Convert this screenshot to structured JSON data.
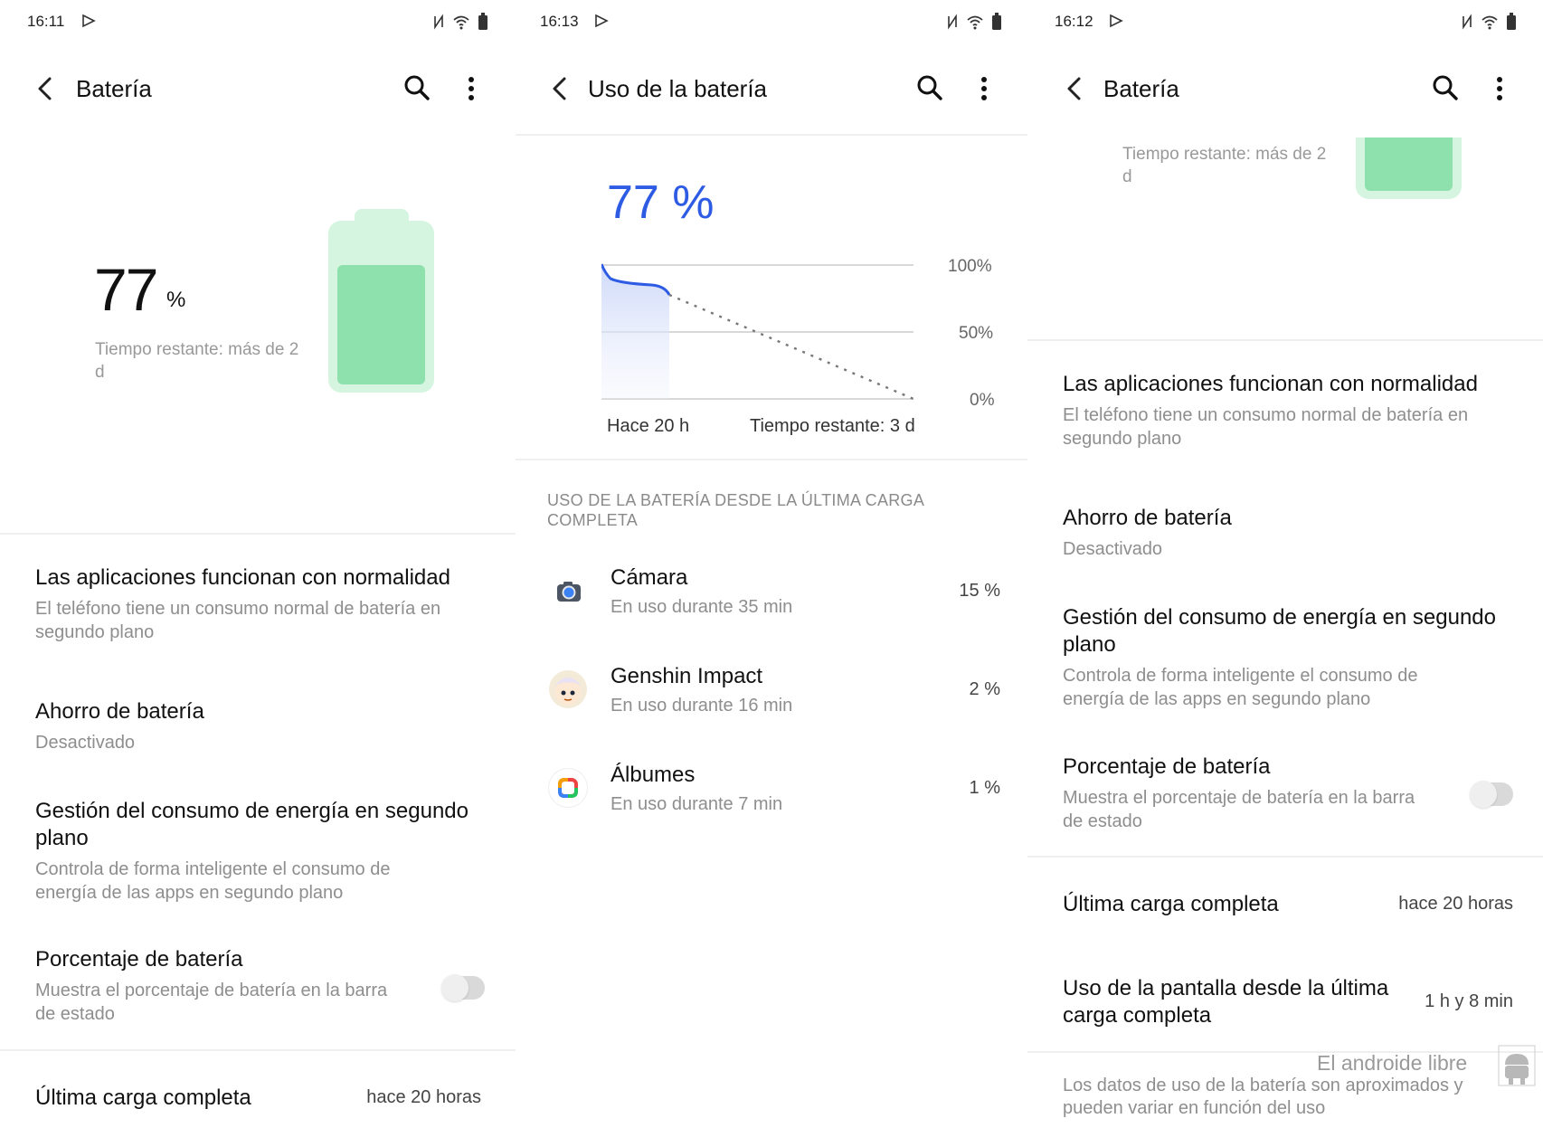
{
  "panel1": {
    "status_time": "16:11",
    "title": "Batería",
    "battery_percent": "77",
    "battery_percent_unit": "%",
    "battery_level": 0.77,
    "time_remaining": "Tiempo restante: más de 2",
    "time_remaining_2": "d",
    "items": [
      {
        "title": "Las aplicaciones funcionan con normalidad",
        "subtitle": "El teléfono tiene un consumo normal de batería en",
        "subtitle2": "segundo plano"
      },
      {
        "title": "Ahorro de batería",
        "subtitle": "Desactivado"
      },
      {
        "title": "Gestión del consumo de energía en segundo",
        "title2": "plano",
        "subtitle": "Controla de forma inteligente el consumo de",
        "subtitle2": "energía de las apps en segundo plano"
      },
      {
        "title": "Porcentaje de batería",
        "subtitle": "Muestra el porcentaje de batería en la barra",
        "subtitle2": "de estado",
        "toggle": false
      },
      {
        "title": "Última carga completa",
        "value": "hace 20 horas"
      }
    ]
  },
  "panel2": {
    "status_time": "16:13",
    "title": "Uso de la batería",
    "battery_percent": "77 %",
    "chart": {
      "y_labels": [
        "100%",
        "50%",
        "0%"
      ],
      "x_left": "Hace 20 h",
      "x_right": "Tiempo restante: 3 d",
      "accent": "#2d5be3"
    },
    "section_header": "USO DE LA BATERÍA DESDE LA ÚLTIMA CARGA",
    "section_header_2": "COMPLETA",
    "apps": [
      {
        "name": "Cámara",
        "usage": "En uso durante 35 min",
        "percent": "15 %",
        "icon": "camera-icon"
      },
      {
        "name": "Genshin Impact",
        "usage": "En uso durante 16 min",
        "percent": "2 %",
        "icon": "genshin-icon"
      },
      {
        "name": "Álbumes",
        "usage": "En uso durante 7 min",
        "percent": "1 %",
        "icon": "albums-icon"
      }
    ]
  },
  "panel3": {
    "status_time": "16:12",
    "title": "Batería",
    "time_remaining": "Tiempo restante: más de 2",
    "time_remaining_2": "d",
    "items": [
      {
        "title": "Las aplicaciones funcionan con normalidad",
        "subtitle": "El teléfono tiene un consumo normal de batería en",
        "subtitle2": "segundo plano"
      },
      {
        "title": "Ahorro de batería",
        "subtitle": "Desactivado"
      },
      {
        "title": "Gestión del consumo de energía en segundo",
        "title2": "plano",
        "subtitle": "Controla de forma inteligente el consumo de",
        "subtitle2": "energía de las apps en segundo plano"
      },
      {
        "title": "Porcentaje de batería",
        "subtitle": "Muestra el porcentaje de batería en la barra",
        "subtitle2": "de estado",
        "toggle": false
      },
      {
        "title": "Última carga completa",
        "value": "hace 20 horas"
      },
      {
        "title": "Uso de la pantalla desde la última",
        "title2": "carga completa",
        "value": "1 h y 8 min"
      }
    ],
    "footer_note": "Los datos de uso de la batería son aproximados y",
    "footer_note_2": "pueden variar en función del uso",
    "watermark": "El androide libre"
  },
  "colors": {
    "battery_fill": "#8ee0ac",
    "battery_shell": "#d5f5e1",
    "accent_blue": "#2d5be3"
  }
}
